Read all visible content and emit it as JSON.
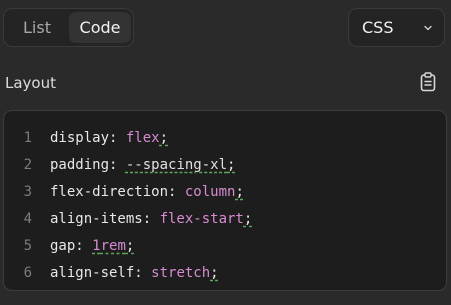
{
  "tabs": {
    "list_label": "List",
    "code_label": "Code",
    "active": "Code"
  },
  "language_select": {
    "value": "CSS",
    "icon": "chevron-down-icon"
  },
  "section": {
    "title": "Layout",
    "copy_icon": "clipboard-icon"
  },
  "colors": {
    "property": "#e8e8e8",
    "value": "#d78bd2",
    "line_number": "#7c7c7c",
    "squiggle": "#5fa45f"
  },
  "code": {
    "lines": [
      {
        "number": "1",
        "property": "display",
        "value": "flex",
        "semicolon": ";"
      },
      {
        "number": "2",
        "property": "padding",
        "value": "--spacing-xl",
        "semicolon": ";"
      },
      {
        "number": "3",
        "property": "flex-direction",
        "value": "column",
        "semicolon": ";"
      },
      {
        "number": "4",
        "property": "align-items",
        "value": "flex-start",
        "semicolon": ";"
      },
      {
        "number": "5",
        "property": "gap",
        "value_num": "1",
        "value_unit": "rem",
        "semicolon": ";"
      },
      {
        "number": "6",
        "property": "align-self",
        "value": "stretch",
        "semicolon": ";"
      }
    ]
  }
}
